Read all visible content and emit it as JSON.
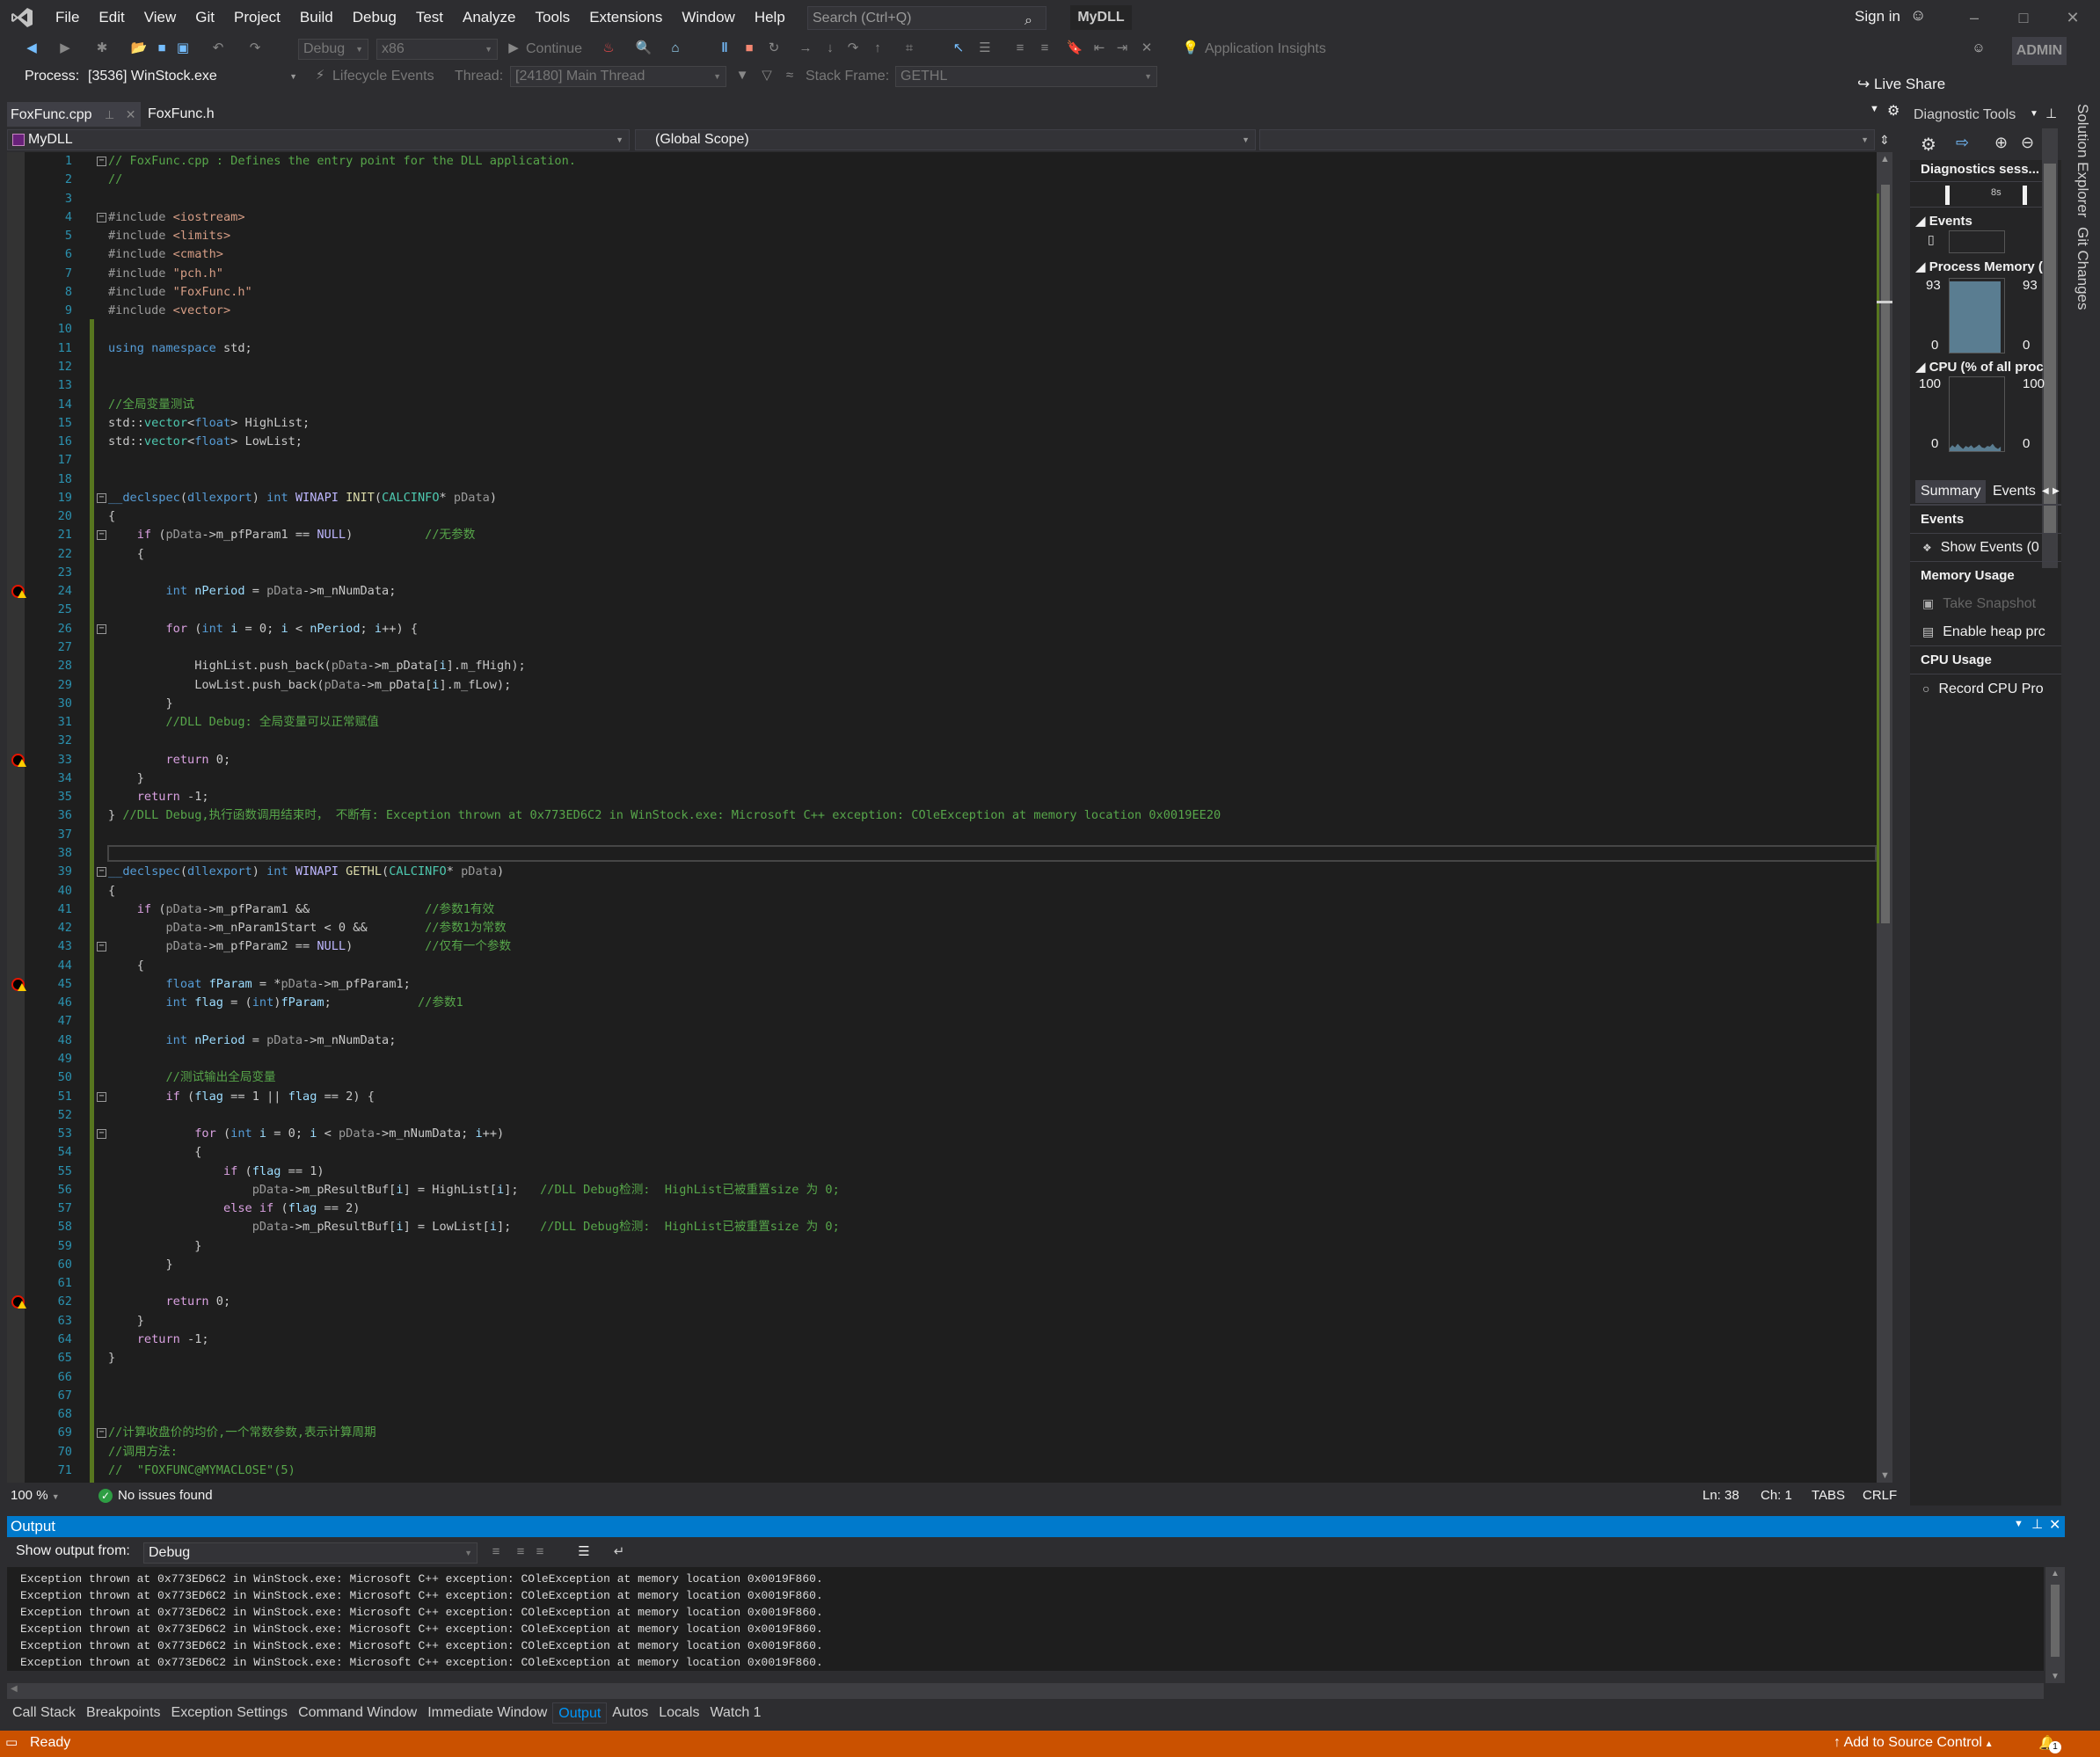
{
  "menubar": {
    "items": [
      "File",
      "Edit",
      "View",
      "Git",
      "Project",
      "Build",
      "Debug",
      "Test",
      "Analyze",
      "Tools",
      "Extensions",
      "Window",
      "Help"
    ],
    "search_placeholder": "Search (Ctrl+Q)",
    "solution_name": "MyDLL",
    "sign_in": "Sign in"
  },
  "toolbar": {
    "configuration": "Debug",
    "platform": "x86",
    "continue_label": "Continue",
    "app_insights_label": "Application Insights",
    "live_share_label": "Live Share",
    "admin_badge": "ADMIN"
  },
  "debug_location": {
    "process_label": "Process:",
    "process_value": "[3536] WinStock.exe",
    "lifecycle_label": "Lifecycle Events",
    "thread_label": "Thread:",
    "thread_value": "[24180] Main Thread",
    "stack_frame_label": "Stack Frame:",
    "stack_frame_value": "GETHL"
  },
  "tabs": [
    {
      "label": "FoxFunc.cpp",
      "active": true
    },
    {
      "label": "FoxFunc.h",
      "active": false
    }
  ],
  "navbar": {
    "project": "MyDLL",
    "scope": "(Global Scope)",
    "member": ""
  },
  "editor": {
    "current_line": 38,
    "breakpoint_lines": [
      24,
      33,
      45,
      62
    ],
    "fold_lines": [
      1,
      4,
      19,
      21,
      26,
      39,
      43,
      51,
      53,
      69
    ],
    "lines": [
      [
        [
          "cm",
          "// FoxFunc.cpp : Defines the entry point for the DLL application."
        ]
      ],
      [
        [
          "cm",
          "//"
        ]
      ],
      [],
      [
        [
          "pp",
          "#include "
        ],
        [
          "str",
          "<iostream>"
        ]
      ],
      [
        [
          "pp",
          "#include "
        ],
        [
          "str",
          "<limits>"
        ]
      ],
      [
        [
          "pp",
          "#include "
        ],
        [
          "str",
          "<cmath>"
        ]
      ],
      [
        [
          "pp",
          "#include "
        ],
        [
          "str",
          "\"pch.h\""
        ]
      ],
      [
        [
          "pp",
          "#include "
        ],
        [
          "str",
          "\"FoxFunc.h\""
        ]
      ],
      [
        [
          "pp",
          "#include "
        ],
        [
          "str",
          "<vector>"
        ]
      ],
      [],
      [
        [
          "kw",
          "using namespace "
        ],
        [
          "glob",
          "std;"
        ]
      ],
      [],
      [],
      [
        [
          "cm",
          "//全局变量测试"
        ]
      ],
      [
        [
          "glob",
          "std::"
        ],
        [
          "type",
          "vector"
        ],
        [
          "glob",
          "<"
        ],
        [
          "kw",
          "float"
        ],
        [
          "glob",
          "> HighList;"
        ]
      ],
      [
        [
          "glob",
          "std::"
        ],
        [
          "type",
          "vector"
        ],
        [
          "glob",
          "<"
        ],
        [
          "kw",
          "float"
        ],
        [
          "glob",
          "> LowList;"
        ]
      ],
      [],
      [],
      [
        [
          "kw",
          "__declspec"
        ],
        [
          "glob",
          "("
        ],
        [
          "kw",
          "dllexport"
        ],
        [
          "glob",
          ") "
        ],
        [
          "kw",
          "int "
        ],
        [
          "mac",
          "WINAPI "
        ],
        [
          "fn",
          "INIT"
        ],
        [
          "glob",
          "("
        ],
        [
          "type",
          "CALCINFO"
        ],
        [
          "glob",
          "* "
        ],
        [
          "par",
          "pData"
        ],
        [
          "glob",
          ")"
        ]
      ],
      [
        [
          "glob",
          "{"
        ]
      ],
      [
        [
          "glob",
          "    "
        ],
        [
          "ctl",
          "if "
        ],
        [
          "glob",
          "("
        ],
        [
          "par",
          "pData"
        ],
        [
          "glob",
          "->m_pfParam1 == "
        ],
        [
          "mac",
          "NULL"
        ],
        [
          "glob",
          ")          "
        ],
        [
          "cm",
          "//无参数"
        ]
      ],
      [
        [
          "glob",
          "    {"
        ]
      ],
      [],
      [
        [
          "glob",
          "        "
        ],
        [
          "kw",
          "int "
        ],
        [
          "loc",
          "nPeriod"
        ],
        [
          "glob",
          " = "
        ],
        [
          "par",
          "pData"
        ],
        [
          "glob",
          "->m_nNumData;"
        ]
      ],
      [],
      [
        [
          "glob",
          "        "
        ],
        [
          "ctl",
          "for "
        ],
        [
          "glob",
          "("
        ],
        [
          "kw",
          "int "
        ],
        [
          "loc",
          "i"
        ],
        [
          "glob",
          " = 0; "
        ],
        [
          "loc",
          "i"
        ],
        [
          "glob",
          " < "
        ],
        [
          "loc",
          "nPeriod"
        ],
        [
          "glob",
          "; "
        ],
        [
          "loc",
          "i"
        ],
        [
          "glob",
          "++) {"
        ]
      ],
      [],
      [
        [
          "glob",
          "            HighList.push_back("
        ],
        [
          "par",
          "pData"
        ],
        [
          "glob",
          "->m_pData["
        ],
        [
          "loc",
          "i"
        ],
        [
          "glob",
          "].m_fHigh);"
        ]
      ],
      [
        [
          "glob",
          "            LowList.push_back("
        ],
        [
          "par",
          "pData"
        ],
        [
          "glob",
          "->m_pData["
        ],
        [
          "loc",
          "i"
        ],
        [
          "glob",
          "].m_fLow);"
        ]
      ],
      [
        [
          "glob",
          "        }"
        ]
      ],
      [
        [
          "glob",
          "        "
        ],
        [
          "cm",
          "//DLL Debug: 全局变量可以正常赋值"
        ]
      ],
      [],
      [
        [
          "glob",
          "        "
        ],
        [
          "ctl",
          "return "
        ],
        [
          "glob",
          "0;"
        ]
      ],
      [
        [
          "glob",
          "    }"
        ]
      ],
      [
        [
          "glob",
          "    "
        ],
        [
          "ctl",
          "return "
        ],
        [
          "glob",
          "-1;"
        ]
      ],
      [
        [
          "glob",
          "} "
        ],
        [
          "cm",
          "//DLL Debug,执行函数调用结束时， 不断有: Exception thrown at 0x773ED6C2 in WinStock.exe: Microsoft C++ exception: COleException at memory location 0x0019EE20"
        ]
      ],
      [],
      [],
      [
        [
          "kw",
          "__declspec"
        ],
        [
          "glob",
          "("
        ],
        [
          "kw",
          "dllexport"
        ],
        [
          "glob",
          ") "
        ],
        [
          "kw",
          "int "
        ],
        [
          "mac",
          "WINAPI "
        ],
        [
          "fn",
          "GETHL"
        ],
        [
          "glob",
          "("
        ],
        [
          "type",
          "CALCINFO"
        ],
        [
          "glob",
          "* "
        ],
        [
          "par",
          "pData"
        ],
        [
          "glob",
          ")"
        ]
      ],
      [
        [
          "glob",
          "{"
        ]
      ],
      [
        [
          "glob",
          "    "
        ],
        [
          "ctl",
          "if "
        ],
        [
          "glob",
          "("
        ],
        [
          "par",
          "pData"
        ],
        [
          "glob",
          "->m_pfParam1 &&                "
        ],
        [
          "cm",
          "//参数1有效"
        ]
      ],
      [
        [
          "glob",
          "        "
        ],
        [
          "par",
          "pData"
        ],
        [
          "glob",
          "->m_nParam1Start < 0 &&        "
        ],
        [
          "cm",
          "//参数1为常数"
        ]
      ],
      [
        [
          "glob",
          "        "
        ],
        [
          "par",
          "pData"
        ],
        [
          "glob",
          "->m_pfParam2 == "
        ],
        [
          "mac",
          "NULL"
        ],
        [
          "glob",
          ")          "
        ],
        [
          "cm",
          "//仅有一个参数"
        ]
      ],
      [
        [
          "glob",
          "    {"
        ]
      ],
      [
        [
          "glob",
          "        "
        ],
        [
          "kw",
          "float "
        ],
        [
          "loc",
          "fParam"
        ],
        [
          "glob",
          " = *"
        ],
        [
          "par",
          "pData"
        ],
        [
          "glob",
          "->m_pfParam1;"
        ]
      ],
      [
        [
          "glob",
          "        "
        ],
        [
          "kw",
          "int "
        ],
        [
          "loc",
          "flag"
        ],
        [
          "glob",
          " = ("
        ],
        [
          "kw",
          "int"
        ],
        [
          "glob",
          ")"
        ],
        [
          "loc",
          "fParam"
        ],
        [
          "glob",
          ";            "
        ],
        [
          "cm",
          "//参数1"
        ]
      ],
      [],
      [
        [
          "glob",
          "        "
        ],
        [
          "kw",
          "int "
        ],
        [
          "loc",
          "nPeriod"
        ],
        [
          "glob",
          " = "
        ],
        [
          "par",
          "pData"
        ],
        [
          "glob",
          "->m_nNumData;"
        ]
      ],
      [],
      [
        [
          "glob",
          "        "
        ],
        [
          "cm",
          "//测试输出全局变量"
        ]
      ],
      [
        [
          "glob",
          "        "
        ],
        [
          "ctl",
          "if "
        ],
        [
          "glob",
          "("
        ],
        [
          "loc",
          "flag"
        ],
        [
          "glob",
          " == 1 || "
        ],
        [
          "loc",
          "flag"
        ],
        [
          "glob",
          " == 2) {"
        ]
      ],
      [],
      [
        [
          "glob",
          "            "
        ],
        [
          "ctl",
          "for "
        ],
        [
          "glob",
          "("
        ],
        [
          "kw",
          "int "
        ],
        [
          "loc",
          "i"
        ],
        [
          "glob",
          " = 0; "
        ],
        [
          "loc",
          "i"
        ],
        [
          "glob",
          " < "
        ],
        [
          "par",
          "pData"
        ],
        [
          "glob",
          "->m_nNumData; "
        ],
        [
          "loc",
          "i"
        ],
        [
          "glob",
          "++)"
        ]
      ],
      [
        [
          "glob",
          "            {"
        ]
      ],
      [
        [
          "glob",
          "                "
        ],
        [
          "ctl",
          "if "
        ],
        [
          "glob",
          "("
        ],
        [
          "loc",
          "flag"
        ],
        [
          "glob",
          " == 1)"
        ]
      ],
      [
        [
          "glob",
          "                    "
        ],
        [
          "par",
          "pData"
        ],
        [
          "glob",
          "->m_pResultBuf["
        ],
        [
          "loc",
          "i"
        ],
        [
          "glob",
          "] = HighList["
        ],
        [
          "loc",
          "i"
        ],
        [
          "glob",
          "];   "
        ],
        [
          "cm",
          "//DLL Debug检测:  HighList已被重置size 为 0;"
        ]
      ],
      [
        [
          "glob",
          "                "
        ],
        [
          "ctl",
          "else if "
        ],
        [
          "glob",
          "("
        ],
        [
          "loc",
          "flag"
        ],
        [
          "glob",
          " == 2)"
        ]
      ],
      [
        [
          "glob",
          "                    "
        ],
        [
          "par",
          "pData"
        ],
        [
          "glob",
          "->m_pResultBuf["
        ],
        [
          "loc",
          "i"
        ],
        [
          "glob",
          "] = LowList["
        ],
        [
          "loc",
          "i"
        ],
        [
          "glob",
          "];    "
        ],
        [
          "cm",
          "//DLL Debug检测:  HighList已被重置size 为 0;"
        ]
      ],
      [
        [
          "glob",
          "            }"
        ]
      ],
      [
        [
          "glob",
          "        }"
        ]
      ],
      [],
      [
        [
          "glob",
          "        "
        ],
        [
          "ctl",
          "return "
        ],
        [
          "glob",
          "0;"
        ]
      ],
      [
        [
          "glob",
          "    }"
        ]
      ],
      [
        [
          "glob",
          "    "
        ],
        [
          "ctl",
          "return "
        ],
        [
          "glob",
          "-1;"
        ]
      ],
      [
        [
          "glob",
          "}"
        ]
      ],
      [],
      [],
      [],
      [
        [
          "cm",
          "//计算收盘价的均价,一个常数参数,表示计算周期"
        ]
      ],
      [
        [
          "cm",
          "//调用方法:"
        ]
      ],
      [
        [
          "cm",
          "//  \"FOXFUNC@MYMACLOSE\"(5)"
        ]
      ]
    ]
  },
  "editor_status": {
    "zoom": "100 %",
    "issues": "No issues found",
    "line": "Ln: 38",
    "col": "Ch: 1",
    "indent": "TABS",
    "eol": "CRLF"
  },
  "output": {
    "title": "Output",
    "show_from_label": "Show output from:",
    "source": "Debug",
    "lines": [
      "Exception thrown at 0x773ED6C2 in WinStock.exe: Microsoft C++ exception: COleException at memory location 0x0019F860.",
      "Exception thrown at 0x773ED6C2 in WinStock.exe: Microsoft C++ exception: COleException at memory location 0x0019F860.",
      "Exception thrown at 0x773ED6C2 in WinStock.exe: Microsoft C++ exception: COleException at memory location 0x0019F860.",
      "Exception thrown at 0x773ED6C2 in WinStock.exe: Microsoft C++ exception: COleException at memory location 0x0019F860.",
      "Exception thrown at 0x773ED6C2 in WinStock.exe: Microsoft C++ exception: COleException at memory location 0x0019F860.",
      "Exception thrown at 0x773ED6C2 in WinStock.exe: Microsoft C++ exception: COleException at memory location 0x0019F860."
    ]
  },
  "bottom_tabs": [
    {
      "label": "Call Stack",
      "active": false
    },
    {
      "label": "Breakpoints",
      "active": false
    },
    {
      "label": "Exception Settings",
      "active": false
    },
    {
      "label": "Command Window",
      "active": false
    },
    {
      "label": "Immediate Window",
      "active": false
    },
    {
      "label": "Output",
      "active": true
    },
    {
      "label": "Autos",
      "active": false
    },
    {
      "label": "Locals",
      "active": false
    },
    {
      "label": "Watch 1",
      "active": false
    }
  ],
  "statusbar": {
    "ready": "Ready",
    "source_control": "Add to Source Control",
    "notifications_count": "1",
    "color": "#ca5100"
  },
  "diagnostics": {
    "title": "Diagnostic Tools",
    "session_label": "Diagnostics sess...",
    "timeline_tick": "8s",
    "events_title": "Events",
    "memory_title": "Process Memory (",
    "memory_max_left": "93",
    "memory_max_right": "93",
    "memory_min_left": "0",
    "memory_min_right": "0",
    "memory_fill_fraction": 0.96,
    "cpu_title": "CPU (% of all proc",
    "cpu_max_left": "100",
    "cpu_max_right": "100",
    "cpu_min_left": "0",
    "cpu_min_right": "0",
    "cpu_samples": [
      4,
      8,
      5,
      10,
      6,
      3,
      7,
      5,
      8,
      4,
      6,
      9,
      5,
      4,
      7,
      6,
      10,
      5,
      3,
      6
    ],
    "tabs": [
      "Summary",
      "Events"
    ],
    "summary": {
      "events_header": "Events",
      "show_events": "Show Events (0",
      "memory_header": "Memory Usage",
      "take_snapshot": "Take Snapshot",
      "enable_heap": "Enable heap prc",
      "cpu_header": "CPU Usage",
      "record_cpu": "Record CPU Pro"
    }
  },
  "side_tabs": [
    "Solution Explorer",
    "Git Changes"
  ]
}
